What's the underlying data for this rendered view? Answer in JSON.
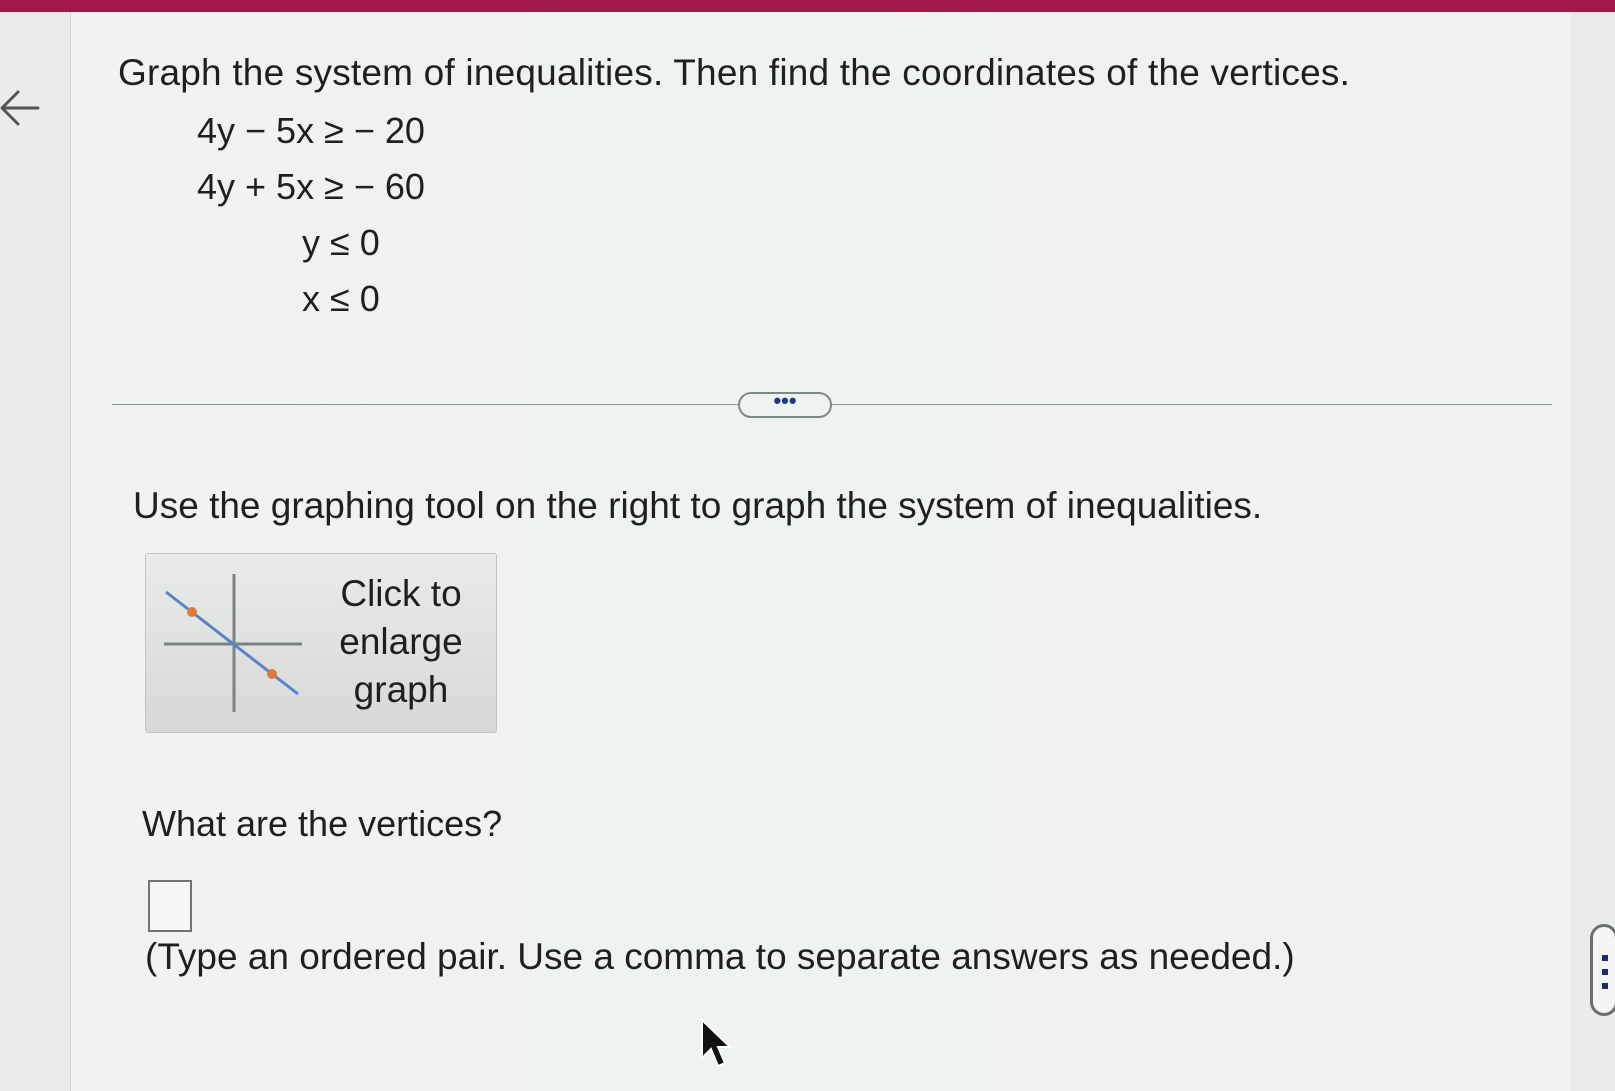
{
  "question": "Graph the system of inequalities. Then find the coordinates of the vertices.",
  "inequalities": [
    "4y − 5x ≥  − 20",
    "4y + 5x ≥  − 60",
    "y ≤ 0",
    "x ≤ 0"
  ],
  "more_button_label": "•••",
  "instruction": "Use the graphing tool on the right to graph the system of inequalities.",
  "graph_button": {
    "line1": "Click to",
    "line2": "enlarge",
    "line3": "graph"
  },
  "vertices_question": "What are the vertices?",
  "answer_value": "",
  "hint": "(Type an ordered pair. Use a comma to separate answers as needed.)",
  "colors": {
    "top_bar": "#a0184a",
    "thumb_line": "#5a83c6",
    "thumb_point": "#e07a3c"
  },
  "icons": [
    "back-arrow-icon",
    "graph-thumbnail-icon",
    "more-options-icon",
    "drag-handle-icon",
    "mouse-pointer-icon"
  ]
}
